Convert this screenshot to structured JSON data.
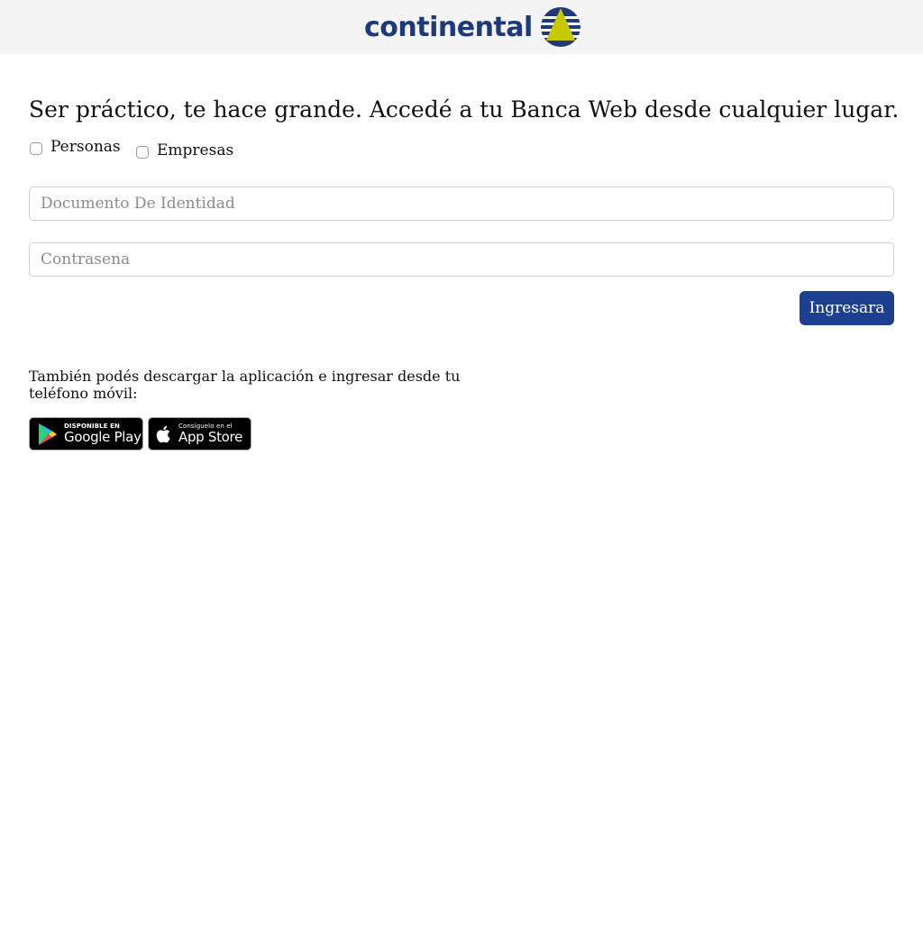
{
  "header": {
    "logo_text": "continental",
    "brand_colors": {
      "navy": "#1e3a7b",
      "yellow": "#c8c800"
    }
  },
  "main": {
    "headline": "Ser práctico, te hace grande. Accedé a tu Banca Web desde cualquier lugar.",
    "user_types": [
      {
        "label": "Personas",
        "checked": false
      },
      {
        "label": "Empresas",
        "checked": false
      }
    ],
    "document_field": {
      "placeholder": "Documento De Identidad",
      "value": ""
    },
    "password_field": {
      "placeholder": "Contrasena",
      "value": ""
    },
    "submit_label": "Ingresara",
    "accent_color": "#1c3f8f"
  },
  "apps": {
    "text": "También podés descargar la aplicación e ingresar desde tu teléfono móvil:",
    "google_play": {
      "small": "DISPONIBLE EN",
      "big": "Google Play",
      "icon": "google-play-icon"
    },
    "app_store": {
      "small": "Consíguelo en el",
      "big": "App Store",
      "icon": "apple-icon"
    }
  }
}
